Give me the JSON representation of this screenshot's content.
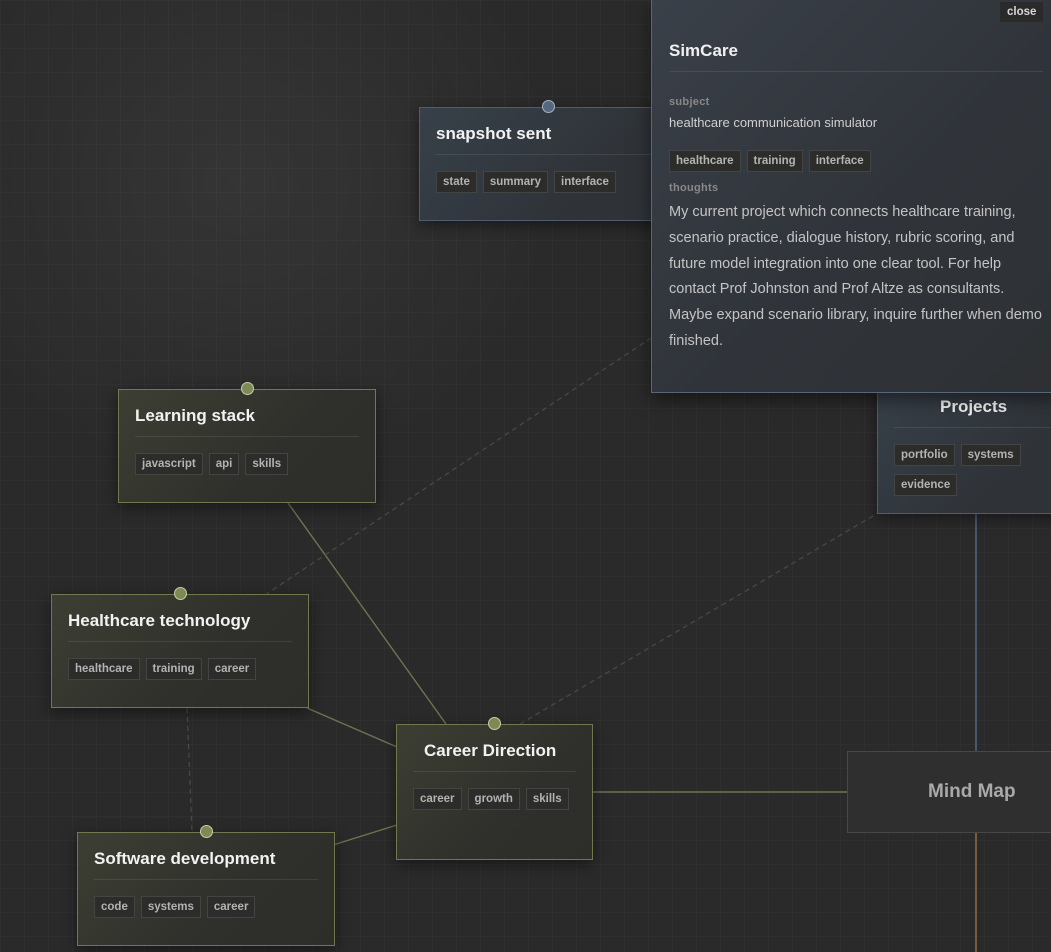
{
  "nodes": {
    "snapshot": {
      "title": "snapshot sent",
      "tags": [
        "state",
        "summary",
        "interface"
      ]
    },
    "learning": {
      "title": "Learning stack",
      "tags": [
        "javascript",
        "api",
        "skills"
      ]
    },
    "healthcare": {
      "title": "Healthcare technology",
      "tags": [
        "healthcare",
        "training",
        "career"
      ]
    },
    "career": {
      "title": "Career Direction",
      "tags": [
        "career",
        "growth",
        "skills"
      ]
    },
    "software": {
      "title": "Software development",
      "tags": [
        "code",
        "systems",
        "career"
      ]
    },
    "projects": {
      "title": "Projects",
      "tags": [
        "portfolio",
        "systems",
        "evidence"
      ]
    }
  },
  "mindmap": {
    "label": "Mind Map"
  },
  "panel": {
    "close_label": "close",
    "title": "SimCare",
    "subject_label": "subject",
    "subject": "healthcare communication simulator",
    "tags": [
      "healthcare",
      "training",
      "interface"
    ],
    "thoughts_label": "thoughts",
    "thoughts": "My current project which connects healthcare training, scenario practice, dialogue history, rubric scoring, and future model integration into one clear tool. For help contact Prof Johnston and Prof Altze as consultants. Maybe expand scenario library, inquire further when demo finished."
  },
  "colors": {
    "canvas": "#2a2a2a",
    "edge_green": "#6f7450",
    "edge_blue": "#50647c",
    "edge_orange": "#8c6a42",
    "port_green": "#7e8a55",
    "port_blue": "#55677c"
  }
}
